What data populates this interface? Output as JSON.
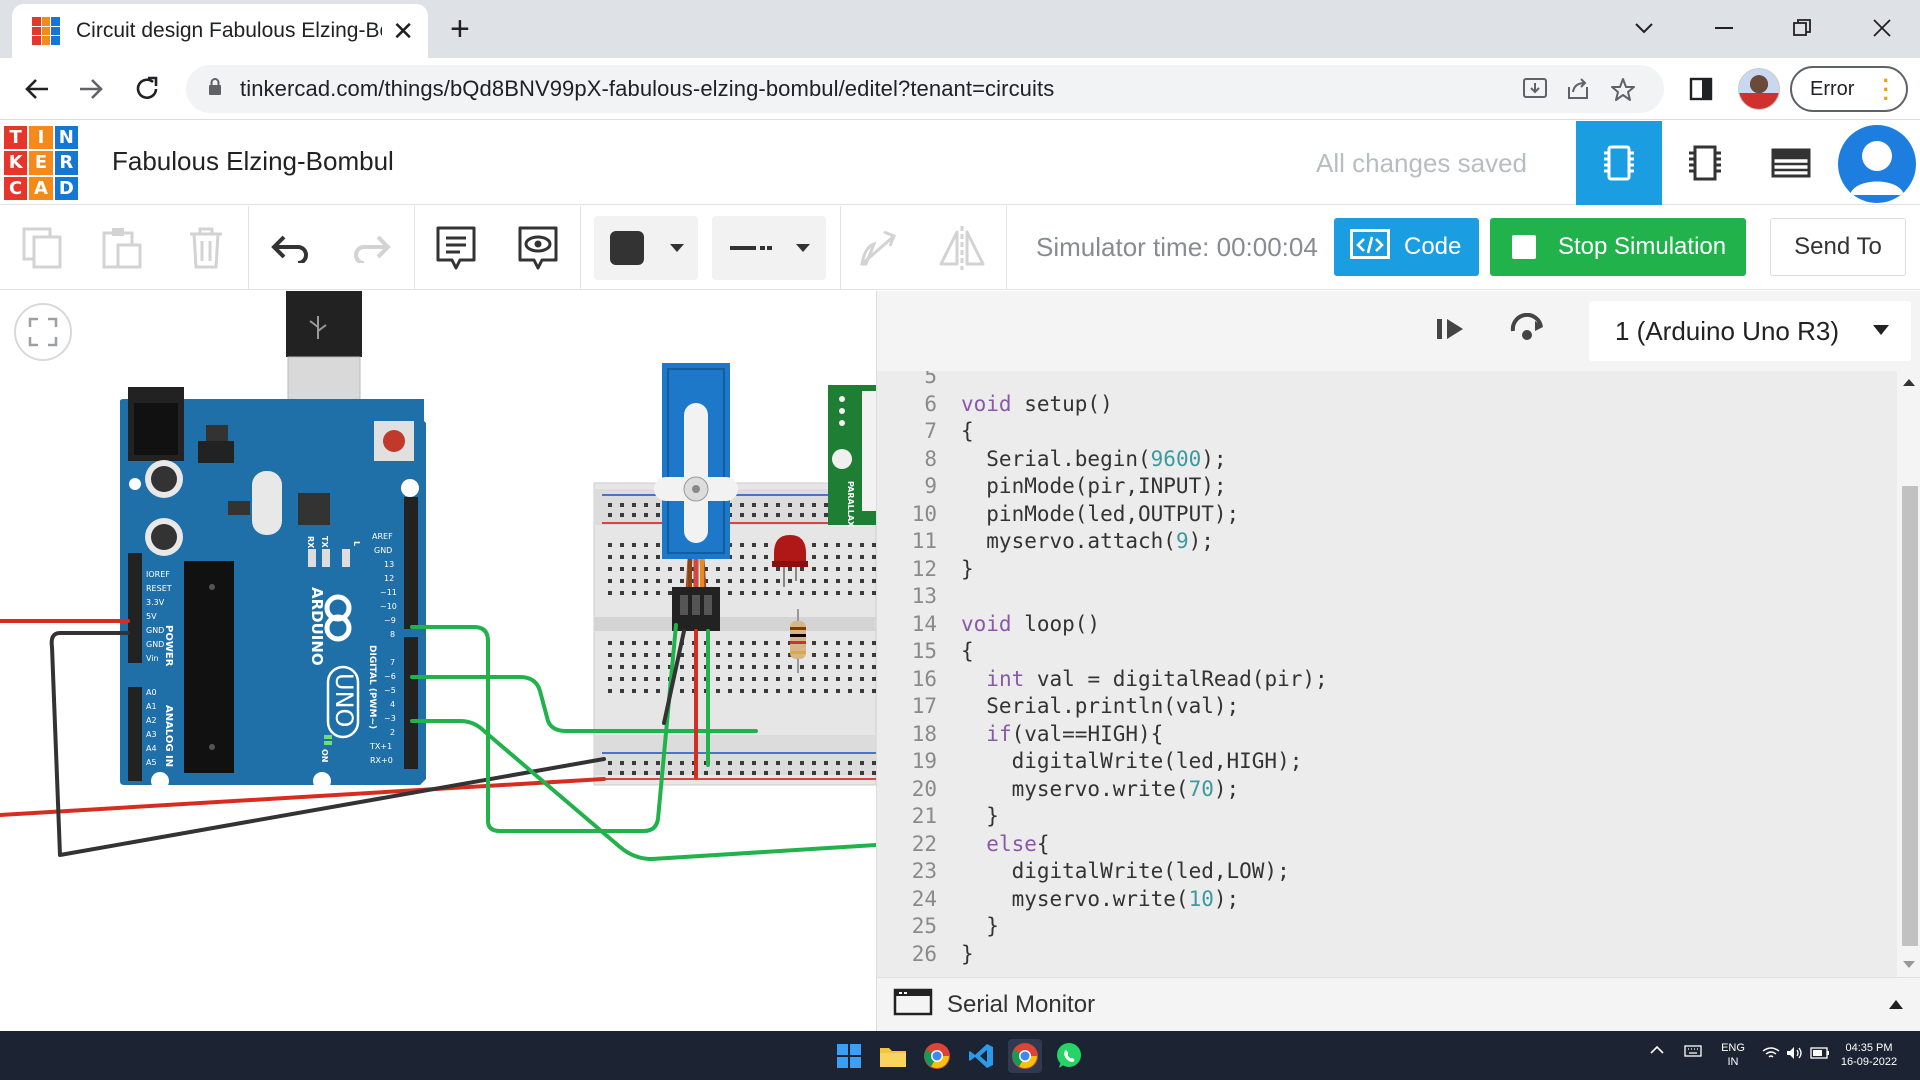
{
  "browser": {
    "tab_title": "Circuit design Fabulous Elzing-Bombul",
    "url": "tinkercad.com/things/bQd8BNV99pX-fabulous-elzing-bombul/editel?tenant=circuits",
    "profile_button_label": "Error"
  },
  "tinkercad": {
    "logo_letters": [
      "T",
      "I",
      "N",
      "K",
      "E",
      "R",
      "C",
      "A",
      "D"
    ],
    "logo_colors": [
      "#e6352b",
      "#f48a1c",
      "#1477d4",
      "#e6352b",
      "#f48a1c",
      "#1477d4",
      "#e6352b",
      "#f48a1c",
      "#1477d4"
    ],
    "project_title": "Fabulous Elzing-Bombul",
    "save_status": "All changes saved",
    "simulator_time": "Simulator time: 00:00:04",
    "code_button": "Code",
    "stop_button": "Stop Simulation",
    "send_button": "Send To",
    "board_select": "1 (Arduino Uno R3)",
    "serial_monitor": "Serial Monitor",
    "accent_color": "#1b9de2",
    "run_color": "#21b24b"
  },
  "arduino_labels": {
    "brand": "ARDUINO",
    "model": "UNO",
    "power": "POWER",
    "analog": "ANALOG IN",
    "digital": "DIGITAL (PWM~)",
    "pins_power": [
      "IOREF",
      "RESET",
      "3.3V",
      "5V",
      "GND",
      "GND",
      "Vin"
    ],
    "pins_analog": [
      "A0",
      "A1",
      "A2",
      "A3",
      "A4",
      "A5"
    ],
    "pins_digital_top": [
      "AREF",
      "GND",
      "13",
      "12",
      "~11",
      "~10",
      "~9",
      "8"
    ],
    "pins_digital_bottom": [
      "7",
      "~6",
      "~5",
      "4",
      "~3",
      "2",
      "TX+1",
      "RX+0"
    ],
    "txrx": [
      "TX",
      "RX"
    ],
    "l": "L",
    "on": "ON",
    "sensor_brand": "PARALLAX"
  },
  "code": {
    "lines": [
      {
        "n": "5",
        "t": ""
      },
      {
        "n": "6",
        "t": "void setup()"
      },
      {
        "n": "7",
        "t": "{"
      },
      {
        "n": "8",
        "t": "  Serial.begin(9600);"
      },
      {
        "n": "9",
        "t": "  pinMode(pir,INPUT);"
      },
      {
        "n": "10",
        "t": "  pinMode(led,OUTPUT);"
      },
      {
        "n": "11",
        "t": "  myservo.attach(9);"
      },
      {
        "n": "12",
        "t": "}"
      },
      {
        "n": "13",
        "t": ""
      },
      {
        "n": "14",
        "t": "void loop()"
      },
      {
        "n": "15",
        "t": "{"
      },
      {
        "n": "16",
        "t": "  int val = digitalRead(pir);"
      },
      {
        "n": "17",
        "t": "  Serial.println(val);"
      },
      {
        "n": "18",
        "t": "  if(val==HIGH){"
      },
      {
        "n": "19",
        "t": "    digitalWrite(led,HIGH);"
      },
      {
        "n": "20",
        "t": "    myservo.write(70);"
      },
      {
        "n": "21",
        "t": "  }"
      },
      {
        "n": "22",
        "t": "  else{"
      },
      {
        "n": "23",
        "t": "    digitalWrite(led,LOW);"
      },
      {
        "n": "24",
        "t": "    myservo.write(10);"
      },
      {
        "n": "25",
        "t": "  }"
      },
      {
        "n": "26",
        "t": "}"
      }
    ]
  },
  "taskbar": {
    "lang_top": "ENG",
    "lang_bottom": "IN",
    "time": "04:35 PM",
    "date": "16-09-2022"
  }
}
